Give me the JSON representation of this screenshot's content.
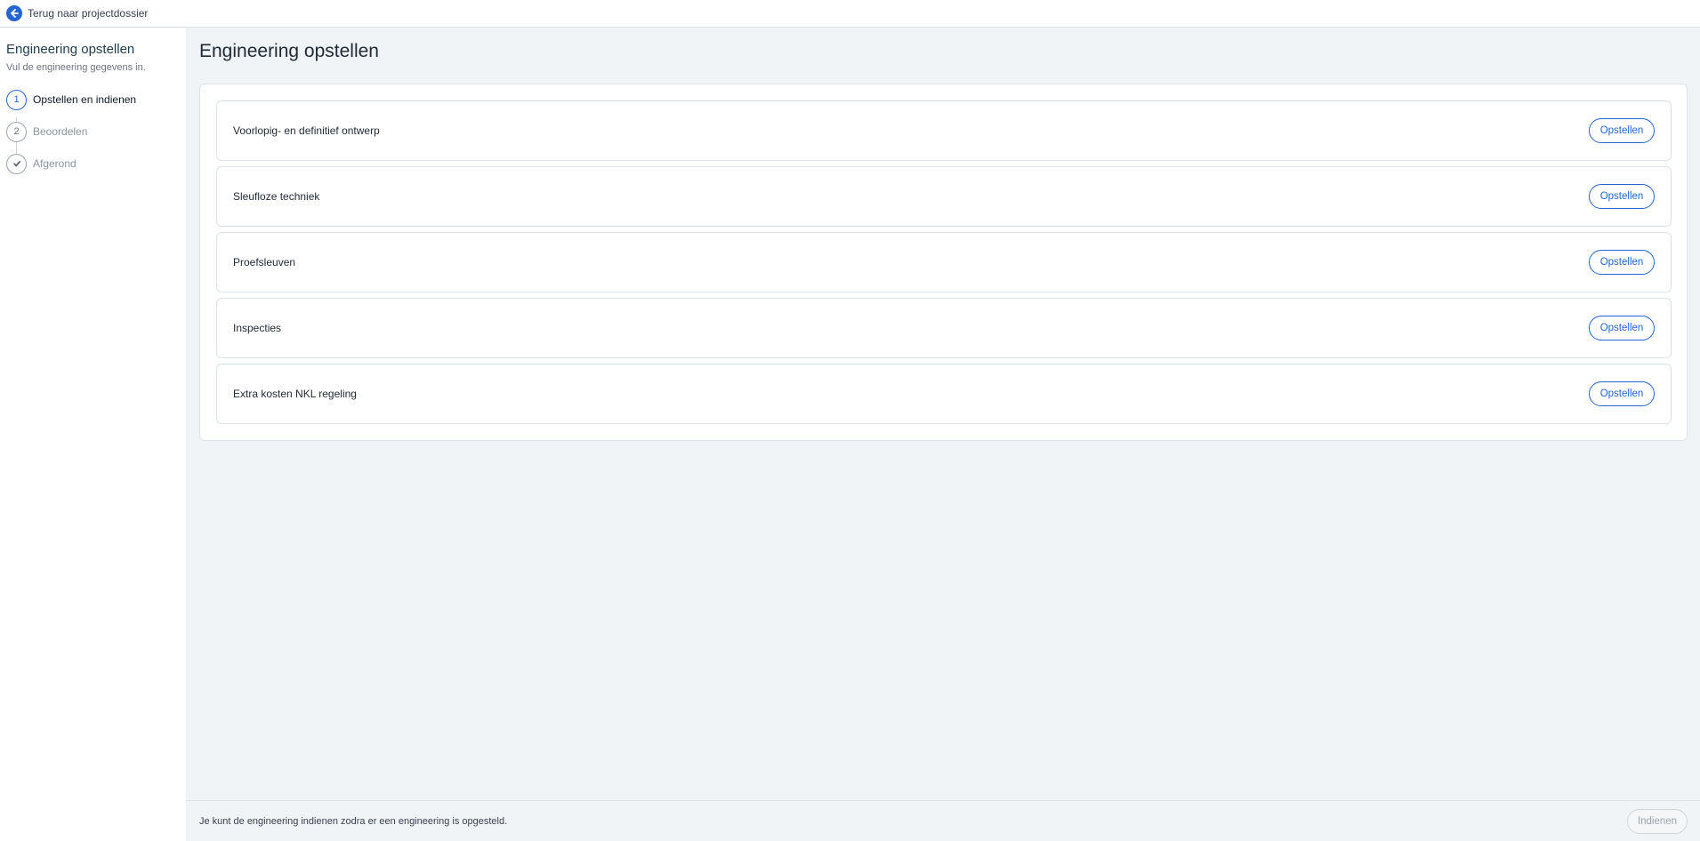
{
  "topbar": {
    "back_label": "Terug naar projectdossier"
  },
  "sidebar": {
    "title": "Engineering opstellen",
    "subtitle": "Vul de engineering gegevens in.",
    "steps": [
      {
        "marker": "1",
        "label": "Opstellen en indienen",
        "state": "active"
      },
      {
        "marker": "2",
        "label": "Beoordelen",
        "state": "pending"
      },
      {
        "marker": "check",
        "label": "Afgerond",
        "state": "pending"
      }
    ]
  },
  "main": {
    "title": "Engineering opstellen",
    "rows": [
      {
        "label": "Voorlopig- en definitief ontwerp",
        "button": "Opstellen"
      },
      {
        "label": "Sleufloze techniek",
        "button": "Opstellen"
      },
      {
        "label": "Proefsleuven",
        "button": "Opstellen"
      },
      {
        "label": "Inspecties",
        "button": "Opstellen"
      },
      {
        "label": "Extra kosten NKL regeling",
        "button": "Opstellen"
      }
    ]
  },
  "footer": {
    "message": "Je kunt de engineering indienen zodra er een engineering is opgesteld.",
    "submit_label": "Indienen"
  },
  "colors": {
    "accent": "#2366d1",
    "background": "#f1f4f7",
    "border": "#dde3ea"
  }
}
